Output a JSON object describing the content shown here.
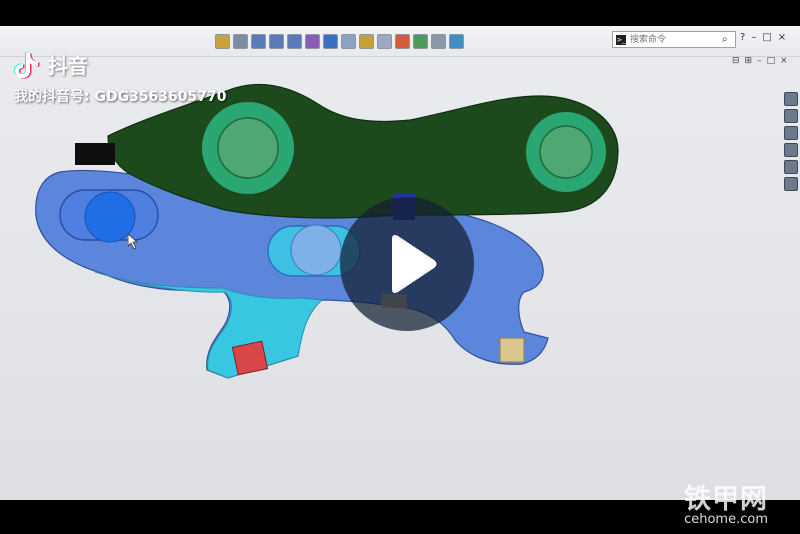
{
  "watermark": {
    "app_name": "抖音",
    "user_id_text": "我的抖音号: GDG3563605770"
  },
  "cad_toolbar": {
    "search_placeholder": "搜索命令",
    "window_controls": [
      "?",
      "–",
      "□",
      "×"
    ],
    "doc_controls": [
      "⊟",
      "⊞",
      "–",
      "□",
      "×"
    ]
  },
  "video": {
    "play_icon": "play-icon"
  },
  "brand": {
    "chinese": "铁甲网",
    "url": "cehome.com"
  },
  "colors": {
    "dark_green_link": "#1d4a1c",
    "pin_green": "#2aa672",
    "blue_body": "#5b86dc",
    "cyan_part": "#38c7e0",
    "red_block": "#d9464a",
    "tan_block": "#d8c68c"
  }
}
